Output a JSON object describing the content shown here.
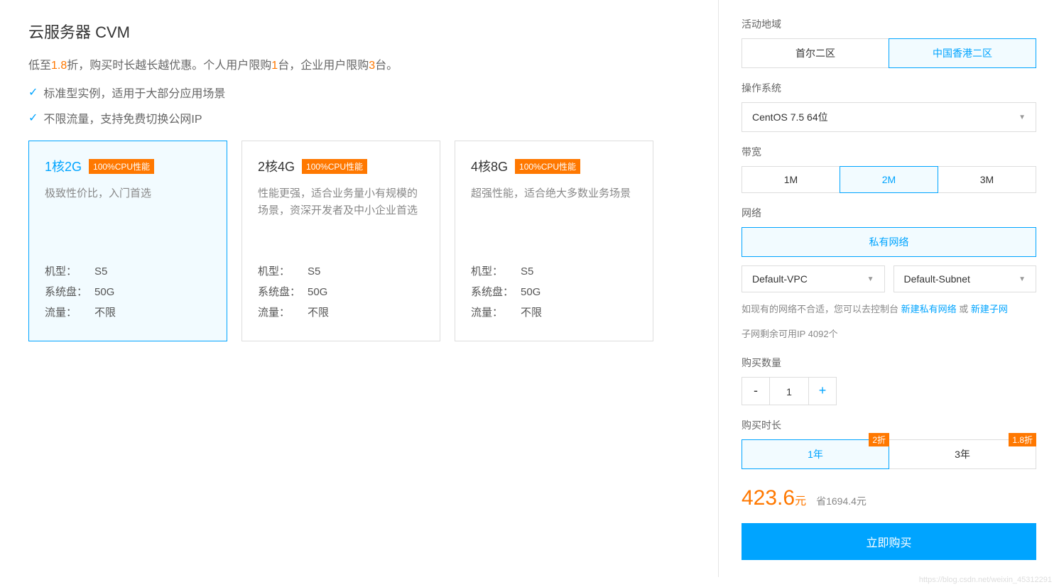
{
  "header": {
    "title": "云服务器 CVM",
    "subtitle_pre": "低至",
    "subtitle_discount": "1.8",
    "subtitle_mid": "折，购买时长越长越优惠。个人用户限购",
    "subtitle_n1": "1",
    "subtitle_mid2": "台，企业用户限购",
    "subtitle_n2": "3",
    "subtitle_end": "台。",
    "check1": "标准型实例，适用于大部分应用场景",
    "check2": "不限流量，支持免费切换公网IP"
  },
  "cards": [
    {
      "spec": "1核2G",
      "badge": "100%CPU性能",
      "desc": "极致性价比，入门首选",
      "model_l": "机型：",
      "model_v": "S5",
      "disk_l": "系统盘：",
      "disk_v": "50G",
      "flow_l": "流量：",
      "flow_v": "不限",
      "selected": true
    },
    {
      "spec": "2核4G",
      "badge": "100%CPU性能",
      "desc": "性能更强，适合业务量小有规模的场景，资深开发者及中小企业首选",
      "model_l": "机型：",
      "model_v": "S5",
      "disk_l": "系统盘：",
      "disk_v": "50G",
      "flow_l": "流量：",
      "flow_v": "不限",
      "selected": false
    },
    {
      "spec": "4核8G",
      "badge": "100%CPU性能",
      "desc": "超强性能，适合绝大多数业务场景",
      "model_l": "机型：",
      "model_v": "S5",
      "disk_l": "系统盘：",
      "disk_v": "50G",
      "flow_l": "流量：",
      "flow_v": "不限",
      "selected": false
    }
  ],
  "config": {
    "region_label": "活动地域",
    "regions": [
      "首尔二区",
      "中国香港二区"
    ],
    "os_label": "操作系统",
    "os_value": "CentOS 7.5 64位",
    "bw_label": "带宽",
    "bw_opts": [
      "1M",
      "2M",
      "3M"
    ],
    "net_label": "网络",
    "net_type": "私有网络",
    "vpc": "Default-VPC",
    "subnet": "Default-Subnet",
    "net_hint_pre": "如现有的网络不合适，您可以去控制台 ",
    "net_link1": "新建私有网络",
    "net_hint_or": " 或 ",
    "net_link2": "新建子网",
    "subnet_ip": "子网剩余可用IP 4092个",
    "qty_label": "购买数量",
    "qty_value": "1",
    "dur_label": "购买时长",
    "dur_opts": [
      {
        "label": "1年",
        "badge": "2折"
      },
      {
        "label": "3年",
        "badge": "1.8折"
      }
    ],
    "price": "423.6",
    "price_unit": "元",
    "save": "省1694.4元",
    "buy": "立即购买"
  },
  "footer_url": "https://blog.csdn.net/weixin_45312291"
}
